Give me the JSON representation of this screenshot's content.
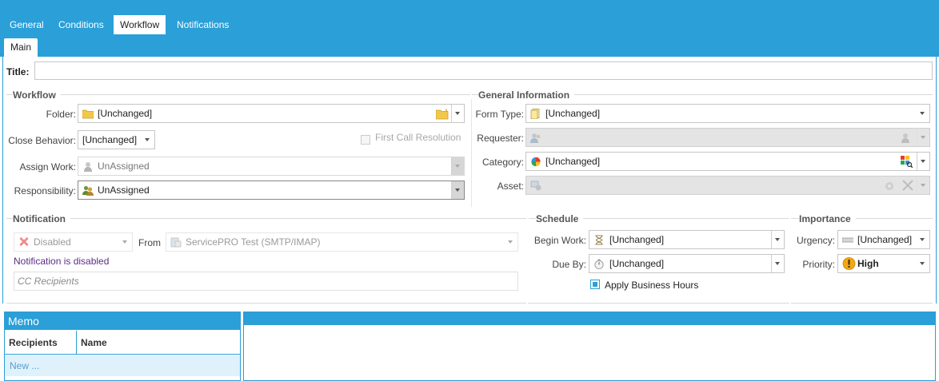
{
  "tabs": [
    {
      "label": "General",
      "active": false
    },
    {
      "label": "Conditions",
      "active": false
    },
    {
      "label": "Workflow",
      "active": true
    },
    {
      "label": "Notifications",
      "active": false
    }
  ],
  "subtab": "Main",
  "title": {
    "label": "Title:",
    "value": ""
  },
  "workflow": {
    "section": "Workflow",
    "folder": {
      "label": "Folder:",
      "value": "[Unchanged]"
    },
    "close_behavior": {
      "label": "Close Behavior:",
      "value": "[Unchanged]"
    },
    "first_call": {
      "label": "First Call Resolution",
      "checked": false
    },
    "assign_work": {
      "label": "Assign Work:",
      "value": "UnAssigned"
    },
    "responsibility": {
      "label": "Responsibility:",
      "value": "UnAssigned"
    }
  },
  "general_info": {
    "section": "General Information",
    "form_type": {
      "label": "Form Type:",
      "value": "[Unchanged]"
    },
    "requester": {
      "label": "Requester:",
      "value": ""
    },
    "category": {
      "label": "Category:",
      "value": "[Unchanged]"
    },
    "asset": {
      "label": "Asset:",
      "value": ""
    }
  },
  "notification": {
    "section": "Notification",
    "status": "Disabled",
    "from_label": "From",
    "from_value": "ServicePRO Test (SMTP/IMAP)",
    "disabled_msg": "Notification is disabled",
    "cc_placeholder": "CC Recipients"
  },
  "schedule": {
    "section": "Schedule",
    "begin_work": {
      "label": "Begin Work:",
      "value": "[Unchanged]"
    },
    "due_by": {
      "label": "Due By:",
      "value": "[Unchanged]"
    },
    "business_hours": {
      "label": "Apply Business Hours",
      "checked": true
    }
  },
  "importance": {
    "section": "Importance",
    "urgency": {
      "label": "Urgency:",
      "value": "[Unchanged]"
    },
    "priority": {
      "label": "Priority:",
      "value": "High"
    }
  },
  "memo": {
    "header": "Memo",
    "columns": [
      "Recipients",
      "Name"
    ],
    "new_row": "New ..."
  },
  "colors": {
    "accent": "#2a9fd8",
    "link_purple": "#5b2d86"
  }
}
